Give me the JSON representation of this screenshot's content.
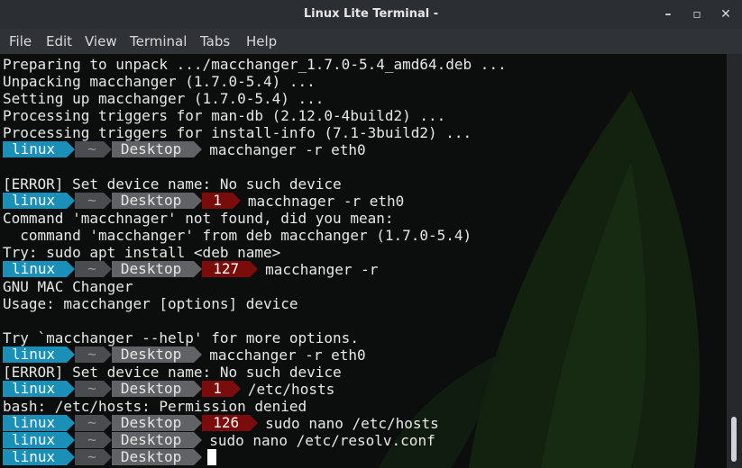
{
  "window": {
    "title": "Linux Lite Terminal -"
  },
  "controls": {
    "minimize": "–",
    "maximize": "▫",
    "close": "✕"
  },
  "menu": [
    "File",
    "Edit",
    "View",
    "Terminal",
    "Tabs",
    "Help"
  ],
  "terminal": {
    "lines": [
      {
        "type": "text",
        "text": "Preparing to unpack .../macchanger_1.7.0-5.4_amd64.deb ..."
      },
      {
        "type": "text",
        "text": "Unpacking macchanger (1.7.0-5.4) ..."
      },
      {
        "type": "text",
        "text": "Setting up macchanger (1.7.0-5.4) ..."
      },
      {
        "type": "text",
        "text": "Processing triggers for man-db (2.12.0-4build2) ..."
      },
      {
        "type": "text",
        "text": "Processing triggers for install-info (7.1-3build2) ..."
      },
      {
        "type": "prompt",
        "user": "linux",
        "home": "~",
        "dir": "Desktop",
        "status": "",
        "cmd": "macchanger -r eth0"
      },
      {
        "type": "text",
        "text": ""
      },
      {
        "type": "text",
        "text": "[ERROR] Set device name: No such device"
      },
      {
        "type": "prompt",
        "user": "linux",
        "home": "~",
        "dir": "Desktop",
        "status": "1",
        "cmd": "macchnager -r eth0"
      },
      {
        "type": "text",
        "text": "Command 'macchnager' not found, did you mean:"
      },
      {
        "type": "text",
        "text": "  command 'macchanger' from deb macchanger (1.7.0-5.4)"
      },
      {
        "type": "text",
        "text": "Try: sudo apt install <deb name>"
      },
      {
        "type": "prompt",
        "user": "linux",
        "home": "~",
        "dir": "Desktop",
        "status": "127",
        "cmd": "macchanger -r"
      },
      {
        "type": "text",
        "text": "GNU MAC Changer"
      },
      {
        "type": "text",
        "text": "Usage: macchanger [options] device"
      },
      {
        "type": "text",
        "text": ""
      },
      {
        "type": "text",
        "text": "Try `macchanger --help' for more options."
      },
      {
        "type": "prompt",
        "user": "linux",
        "home": "~",
        "dir": "Desktop",
        "status": "",
        "cmd": "macchanger -r eth0"
      },
      {
        "type": "text",
        "text": "[ERROR] Set device name: No such device"
      },
      {
        "type": "prompt",
        "user": "linux",
        "home": "~",
        "dir": "Desktop",
        "status": "1",
        "cmd": "/etc/hosts"
      },
      {
        "type": "text",
        "text": "bash: /etc/hosts: Permission denied"
      },
      {
        "type": "prompt",
        "user": "linux",
        "home": "~",
        "dir": "Desktop",
        "status": "126",
        "cmd": "sudo nano /etc/hosts"
      },
      {
        "type": "prompt",
        "user": "linux",
        "home": "~",
        "dir": "Desktop",
        "status": "",
        "cmd": "sudo nano /etc/resolv.conf"
      },
      {
        "type": "prompt",
        "user": "linux",
        "home": "~",
        "dir": "Desktop",
        "status": "",
        "cmd": "",
        "cursor": true
      }
    ]
  },
  "colors": {
    "user_segment": "#1a8fb7",
    "error_segment": "#7a0c0c",
    "background": "#0c0d0d"
  }
}
